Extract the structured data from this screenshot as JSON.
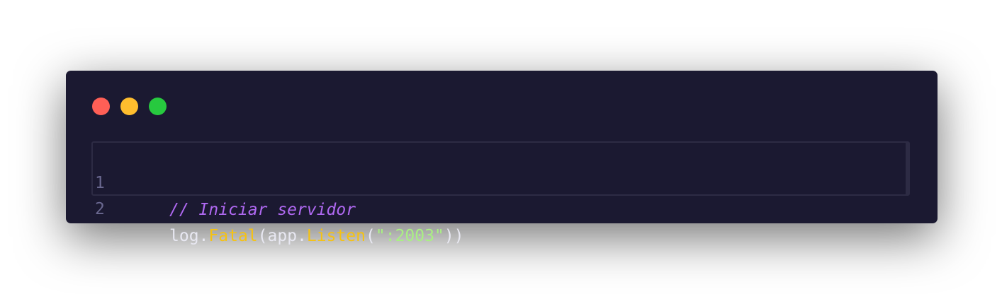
{
  "window": {
    "traffic_lights": [
      {
        "name": "close",
        "color": "#ff5f56"
      },
      {
        "name": "minimize",
        "color": "#ffbd2e"
      },
      {
        "name": "maximize",
        "color": "#27c93f"
      }
    ],
    "background": "#1b1931"
  },
  "editor": {
    "lines": [
      {
        "number": "1",
        "tokens": {
          "comment": "// Iniciar servidor"
        }
      },
      {
        "number": "2",
        "tokens": {
          "obj1": "log",
          "dot1": ".",
          "func1": "Fatal",
          "paren_open1": "(",
          "obj2": "app",
          "dot2": ".",
          "func2": "Listen",
          "paren_open2": "(",
          "string": "\":2003\"",
          "paren_close": "))"
        }
      }
    ]
  },
  "colors": {
    "comment": "#b069f2",
    "function": "#f5c213",
    "string": "#a9f083",
    "plain": "#e8e8f2",
    "line_number": "#6a6890"
  }
}
